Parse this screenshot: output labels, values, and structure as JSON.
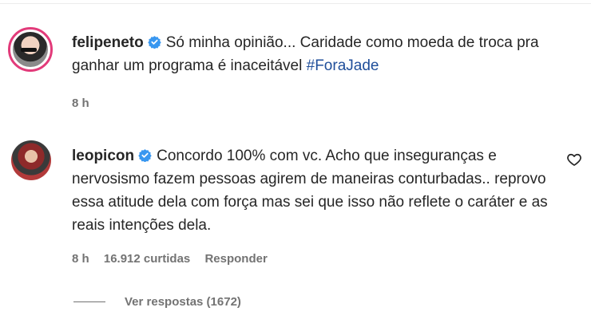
{
  "comments": [
    {
      "username": "felipeneto",
      "text": "Só minha opinião... Caridade como moeda de troca pra ganhar um programa é inaceitável",
      "hashtag": "#ForaJade",
      "time": "8 h"
    },
    {
      "username": "leopicon",
      "text": "Concordo 100% com vc. Acho que inseguranças e nervosismo fazem pessoas agirem de maneiras conturbadas.. reprovo essa atitude dela com força mas sei que isso não reflete o caráter e as reais intenções dela.",
      "time": "8 h",
      "likes": "16.912 curtidas",
      "reply_label": "Responder"
    }
  ],
  "view_replies": "Ver respostas (1672)",
  "colors": {
    "verified": "#3897f0",
    "hashtag": "#1f4e9a",
    "meta": "#737373"
  },
  "icons": [
    "verified-badge-icon",
    "heart-icon"
  ]
}
